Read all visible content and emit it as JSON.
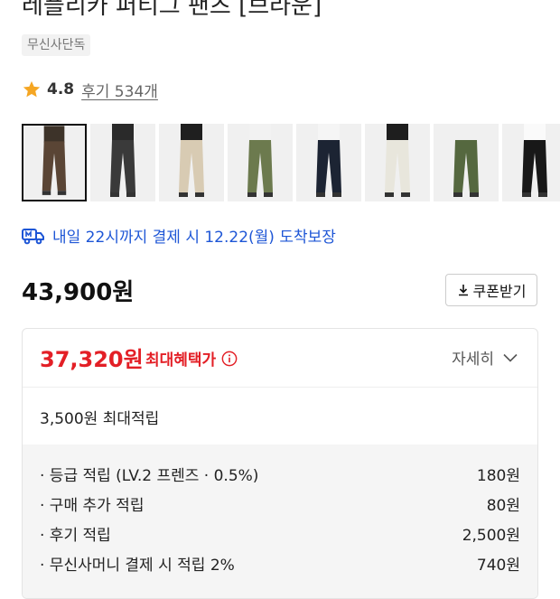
{
  "product": {
    "title": "레플리카 퍼티그 팬츠 [브라운]",
    "badge": "무신사단독",
    "rating": "4.8",
    "review_link": "후기 534개"
  },
  "thumbnails": [
    {
      "name": "thumb-brown",
      "pants": "#5a4535",
      "top": "#3d3329",
      "selected": true
    },
    {
      "name": "thumb-charcoal",
      "pants": "#3a3a3a",
      "top": "#2a2a2a",
      "selected": false
    },
    {
      "name": "thumb-beige",
      "pants": "#d8cbb3",
      "top": "#1f1f1f",
      "selected": false
    },
    {
      "name": "thumb-olive",
      "pants": "#6c7a4e",
      "top": "#f2f2f2",
      "selected": false
    },
    {
      "name": "thumb-navy",
      "pants": "#1c2433",
      "top": "#f5f5f5",
      "selected": false
    },
    {
      "name": "thumb-ivory",
      "pants": "#e8e6dc",
      "top": "#1e1e1e",
      "selected": false
    },
    {
      "name": "thumb-green",
      "pants": "#55683f",
      "top": "#f0f0f0",
      "selected": false
    },
    {
      "name": "thumb-black",
      "pants": "#181818",
      "top": "#fafafa",
      "selected": false
    }
  ],
  "delivery": {
    "text": "내일 22시까지 결제 시 12.22(월) 도착보장",
    "color": "#1e56d6"
  },
  "pricing": {
    "price": "43,900원",
    "coupon_button": "쿠폰받기",
    "max_benefit_price": "37,320원",
    "max_benefit_label": "최대혜택가",
    "detail_button": "자세히",
    "points_total": "3,500원 최대적립",
    "accent_color": "#e31f26"
  },
  "points": [
    {
      "label": "· 등급 적립 (LV.2 프렌즈 · 0.5%)",
      "value": "180원"
    },
    {
      "label": "· 구매 추가 적립",
      "value": "80원"
    },
    {
      "label": "· 후기 적립",
      "value": "2,500원"
    },
    {
      "label": "· 무신사머니 결제 시 적립 2%",
      "value": "740원"
    }
  ]
}
